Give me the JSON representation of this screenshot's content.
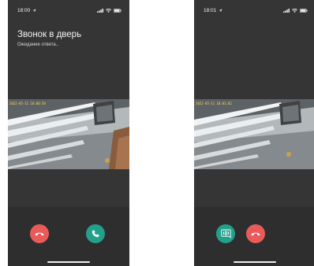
{
  "screens": [
    {
      "status_time": "18:00",
      "title": "Звонок в дверь",
      "status_text": "Ожидание ответа..",
      "video_timestamp": "2022-05-11 18:00:58"
    },
    {
      "status_time": "18:01",
      "title": "",
      "status_text": "",
      "video_timestamp": "2022-05-11 18:01:02"
    }
  ],
  "icons": {
    "decline": "phone-hangup-icon",
    "accept": "phone-icon",
    "open_door": "intercom-icon",
    "location": "location-arrow-icon",
    "signal": "signal-icon",
    "wifi": "wifi-icon",
    "battery": "battery-icon"
  },
  "colors": {
    "background": "#353535",
    "decline": "#e95b5b",
    "accept": "#23a08a"
  }
}
